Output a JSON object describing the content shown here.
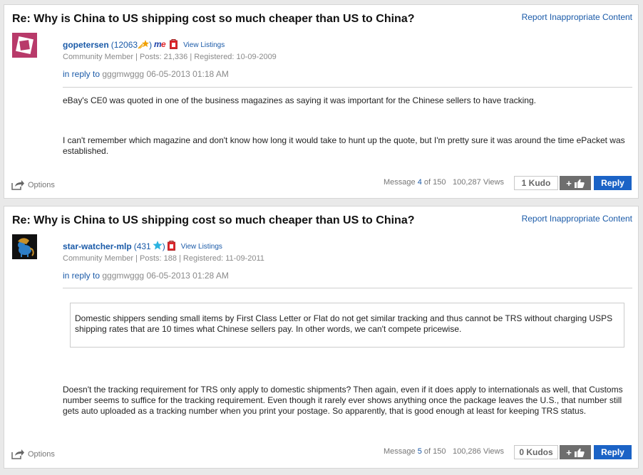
{
  "posts": [
    {
      "title": "Re: Why is China to US shipping cost so much cheaper than US to China?",
      "report": "Report Inappropriate Content",
      "author": "gopetersen",
      "score": "12063",
      "view_listings": "View Listings",
      "meta": "Community Member | Posts: 21,336 | Registered: 10-09-2009",
      "in_reply_to": "in reply to",
      "reply_user": "gggmwggg",
      "reply_date": "06-05-2013 01:18 AM",
      "paragraphs": [
        "eBay's CE0 was quoted in one of the business magazines as saying it was important for the Chinese sellers to have tracking.",
        "I can't remember which magazine and don't know how long it would take to hunt up the quote, but I'm pretty sure it was around the time ePacket was established."
      ],
      "options": "Options",
      "message_label": "Message",
      "message_num": "4",
      "message_of": "of 150",
      "views": "100,287 Views",
      "kudos": "1 Kudo",
      "plus": "+",
      "reply": "Reply"
    },
    {
      "title": "Re: Why is China to US shipping cost so much cheaper than US to China?",
      "report": "Report Inappropriate Content",
      "author": "star-watcher-mlp",
      "score": "431",
      "view_listings": "View Listings",
      "meta": "Community Member | Posts: 188 | Registered: 11-09-2011",
      "in_reply_to": "in reply to",
      "reply_user": "gggmwggg",
      "reply_date": "06-05-2013 01:28 AM",
      "quote": "Domestic shippers sending small items by First Class Letter or Flat do not get similar tracking and thus cannot be TRS without charging USPS shipping rates that are 10 times what Chinese sellers pay. In other words, we can't compete pricewise.",
      "paragraphs": [
        "Doesn't the tracking requirement for TRS only apply to domestic shipments?  Then again, even if it does apply to internationals as well, that Customs number seems to suffice for the tracking requirement.  Even though it rarely ever shows anything once the package leaves the U.S., that number still gets auto uploaded as a tracking number when you print your postage.  So apparently, that is good enough at least for keeping TRS status."
      ],
      "options": "Options",
      "message_label": "Message",
      "message_num": "5",
      "message_of": "of 150",
      "views": "100,286 Views",
      "kudos": "0 Kudos",
      "plus": "+",
      "reply": "Reply"
    }
  ],
  "colors": {
    "link": "#1a5aa8",
    "reply_button": "#1b63c6",
    "kudo_button": "#6e6e6e",
    "star_gold": "#f0a000",
    "star_teal": "#2bb3e0"
  },
  "icons": [
    "share-icon",
    "thumbs-up-icon",
    "star-icon",
    "me-badge-icon",
    "red-shopping-bag-icon"
  ]
}
